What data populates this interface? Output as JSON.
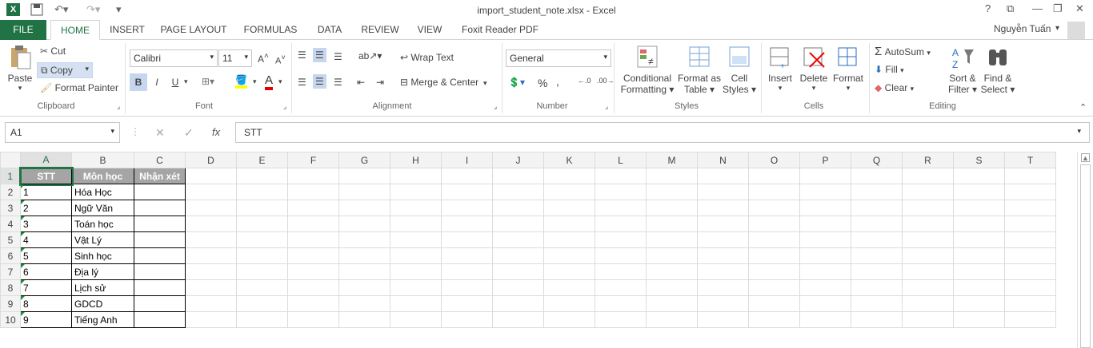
{
  "window": {
    "title": "import_student_note.xlsx - Excel",
    "user": "Nguyễn Tuấn"
  },
  "tabs": [
    "FILE",
    "HOME",
    "INSERT",
    "PAGE LAYOUT",
    "FORMULAS",
    "DATA",
    "REVIEW",
    "VIEW",
    "Foxit Reader PDF"
  ],
  "clipboard": {
    "paste": "Paste",
    "cut": "Cut",
    "copy": "Copy",
    "format_painter": "Format Painter",
    "label": "Clipboard"
  },
  "font": {
    "name": "Calibri",
    "size": "11",
    "bold": "B",
    "italic": "I",
    "underline": "U",
    "label": "Font"
  },
  "alignment": {
    "wrap": "Wrap Text",
    "merge": "Merge & Center",
    "label": "Alignment"
  },
  "number": {
    "format": "General",
    "label": "Number"
  },
  "styles": {
    "conditional1": "Conditional",
    "conditional2": "Formatting",
    "format_as1": "Format as",
    "format_as2": "Table",
    "cell1": "Cell",
    "cell2": "Styles",
    "label": "Styles"
  },
  "cells": {
    "insert": "Insert",
    "delete": "Delete",
    "format": "Format",
    "label": "Cells"
  },
  "editing": {
    "autosum": "AutoSum",
    "fill": "Fill",
    "clear": "Clear",
    "sort1": "Sort &",
    "sort2": "Filter",
    "find1": "Find &",
    "find2": "Select",
    "label": "Editing"
  },
  "formula_bar": {
    "name_box": "A1",
    "fx": "fx",
    "value": "STT"
  },
  "columns": [
    "A",
    "B",
    "C",
    "D",
    "E",
    "F",
    "G",
    "H",
    "I",
    "J",
    "K",
    "L",
    "M",
    "N",
    "O",
    "P",
    "Q",
    "R",
    "S",
    "T"
  ],
  "sheet": {
    "headers": [
      "STT",
      "Môn học",
      "Nhận xét"
    ],
    "rows": [
      [
        "1",
        "Hóa Học"
      ],
      [
        "2",
        "Ngữ Văn"
      ],
      [
        "3",
        "Toán học"
      ],
      [
        "4",
        "Vật Lý"
      ],
      [
        "5",
        "Sinh học"
      ],
      [
        "6",
        "Địa lý"
      ],
      [
        "7",
        "Lịch sử"
      ],
      [
        "8",
        "GDCD"
      ],
      [
        "9",
        "Tiếng Anh"
      ]
    ]
  },
  "colors": {
    "accent": "#217346",
    "header_fill": "#a5a5a5"
  }
}
